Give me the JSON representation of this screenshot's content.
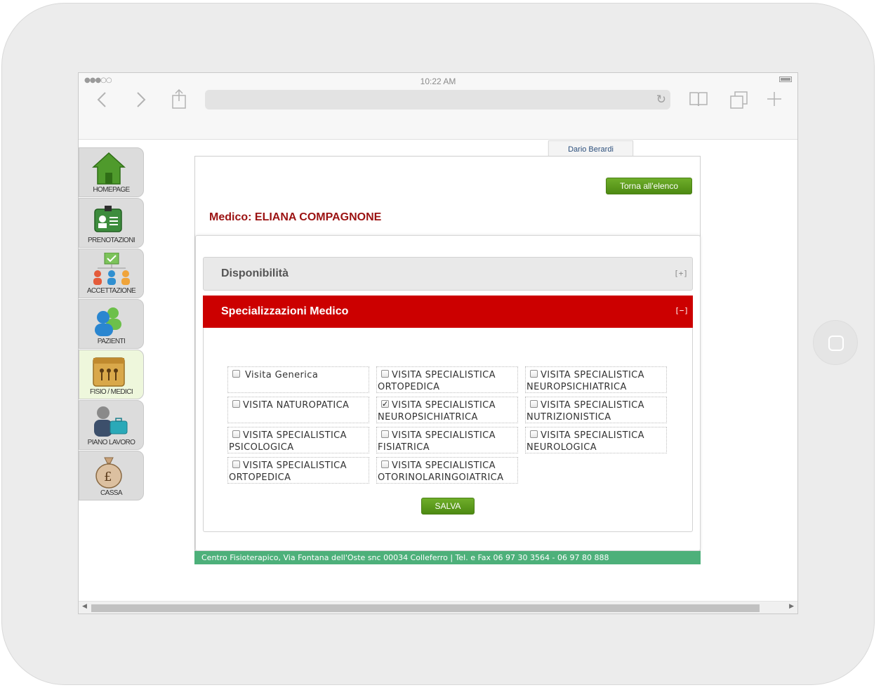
{
  "device": {
    "clock": "10:22 AM",
    "signal": "●●●○○"
  },
  "browser": {
    "back_icon": "chevron-left-icon",
    "forward_icon": "chevron-right-icon",
    "share_icon": "share-icon",
    "reload_icon": "reload-icon",
    "bookmarks_icon": "book-icon",
    "tabs_icon": "tabs-icon",
    "new_tab_icon": "plus-icon"
  },
  "sidebar": {
    "items": [
      {
        "label": "HOMEPAGE",
        "icon": "home-icon"
      },
      {
        "label": "PRENOTAZIONI",
        "icon": "id-card-icon"
      },
      {
        "label": "ACCETTAZIONE",
        "icon": "org-chart-icon"
      },
      {
        "label": "PAZIENTI",
        "icon": "users-icon"
      },
      {
        "label": "FISIO / MEDICI",
        "icon": "team-folder-icon"
      },
      {
        "label": "PIANO LAVORO",
        "icon": "worker-briefcase-icon"
      },
      {
        "label": "CASSA",
        "icon": "money-bag-icon"
      }
    ],
    "active_index": 4
  },
  "user": {
    "name": "Dario Berardi"
  },
  "page": {
    "back_button": "Torna all'elenco",
    "title": "Medico: ELIANA COMPAGNONE"
  },
  "accordion": {
    "disponibilita": {
      "title": "Disponibilità",
      "toggle": "[+]"
    },
    "specializzazioni": {
      "title": "Specializzazioni  Medico",
      "toggle": "[−]"
    }
  },
  "specializations": [
    {
      "label": "Visita  Generica",
      "checked": false
    },
    {
      "label": "VISITA SPECIALISTICA ORTOPEDICA",
      "checked": false
    },
    {
      "label": "VISITA SPECIALISTICA NEUROPSICHIATRICA",
      "checked": false
    },
    {
      "label": "VISITA NATUROPATICA",
      "checked": false
    },
    {
      "label": "VISITA SPECIALISTICA NEUROPSICHIATRICA",
      "checked": true
    },
    {
      "label": "VISITA SPECIALISTICA NUTRIZIONISTICA",
      "checked": false
    },
    {
      "label": "VISITA SPECIALISTICA PSICOLOGICA",
      "checked": false
    },
    {
      "label": "VISITA SPECIALISTICA FISIATRICA",
      "checked": false
    },
    {
      "label": "VISITA SPECIALISTICA NEUROLOGICA",
      "checked": false
    },
    {
      "label": "VISITA SPECIALISTICA ORTOPEDICA",
      "checked": false
    },
    {
      "label": "VISITA SPECIALISTICA OTORINOLARINGOIATRICA",
      "checked": false
    }
  ],
  "save_button": "SALVA",
  "footer": "Centro Fisioterapico, Via Fontana dell'Oste snc 00034 Colleferro | Tel. e Fax 06 97 30 3564 - 06 97 80 888",
  "colors": {
    "accent_red": "#cc0000",
    "title_red": "#9b1212",
    "button_green": "#5a9a1a",
    "footer_green": "#4db07a"
  }
}
